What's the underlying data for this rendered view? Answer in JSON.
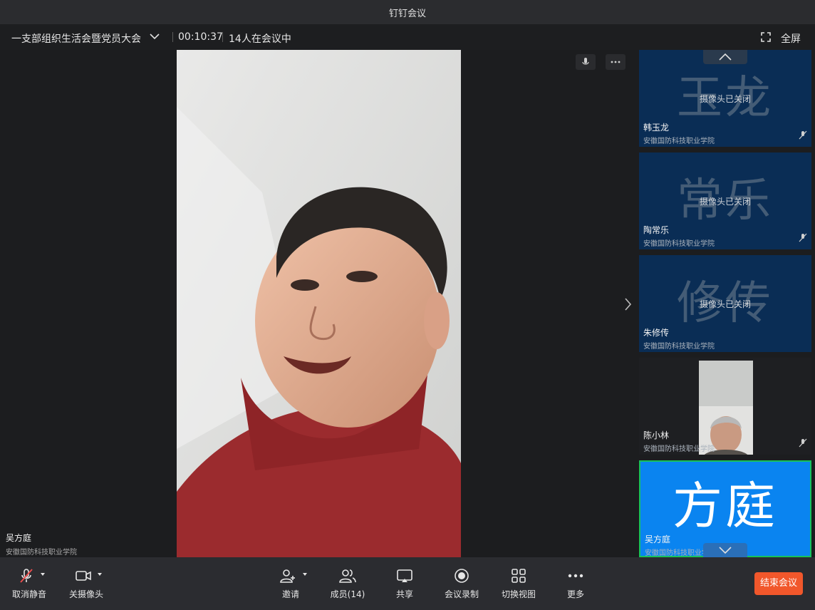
{
  "window": {
    "title": "钉钉会议"
  },
  "meeting": {
    "title": "一支部组织生活会暨党员大会",
    "elapsed": "00:10:37",
    "participants_text": "14人在会议中",
    "fullscreen_label": "全屏"
  },
  "stage": {
    "speaker_name": "吴方庭",
    "speaker_org": "安徽国防科技职业学院"
  },
  "side_tiles": [
    {
      "avatar_text": "玉龙",
      "camera_status": "摄像头已关闭",
      "name": "韩玉龙",
      "org": "安徽国防科技职业学院"
    },
    {
      "avatar_text": "常乐",
      "camera_status": "摄像头已关闭",
      "name": "陶常乐",
      "org": "安徽国防科技职业学院"
    },
    {
      "avatar_text": "修传",
      "camera_status": "摄像头已关闭",
      "name": "朱修传",
      "org": "安徽国防科技职业学院"
    },
    {
      "name": "陈小林",
      "org": "安徽国防科技职业学院"
    },
    {
      "avatar_text": "方庭",
      "name": "吴方庭",
      "org": "安徽国防科技职业学院"
    }
  ],
  "toolbar": {
    "unmute": "取消静音",
    "camera_off": "关摄像头",
    "invite": "邀请",
    "members": "成员(14)",
    "share": "共享",
    "record": "会议录制",
    "switch_view": "切换视图",
    "more": "更多",
    "end_meeting": "结束会议"
  },
  "colors": {
    "accent_blue": "#0a84f0",
    "end_button": "#f1572b",
    "active_border": "#18c25a",
    "tile_bg": "#0a2d55"
  },
  "icons": [
    "mic-muted-icon",
    "camera-icon",
    "add-person-icon",
    "members-icon",
    "share-screen-icon",
    "record-icon",
    "grid-view-icon",
    "more-dots-icon",
    "fullscreen-icon",
    "chevron-down-icon",
    "chevron-right-icon",
    "mic-icon",
    "ellipsis-icon"
  ]
}
